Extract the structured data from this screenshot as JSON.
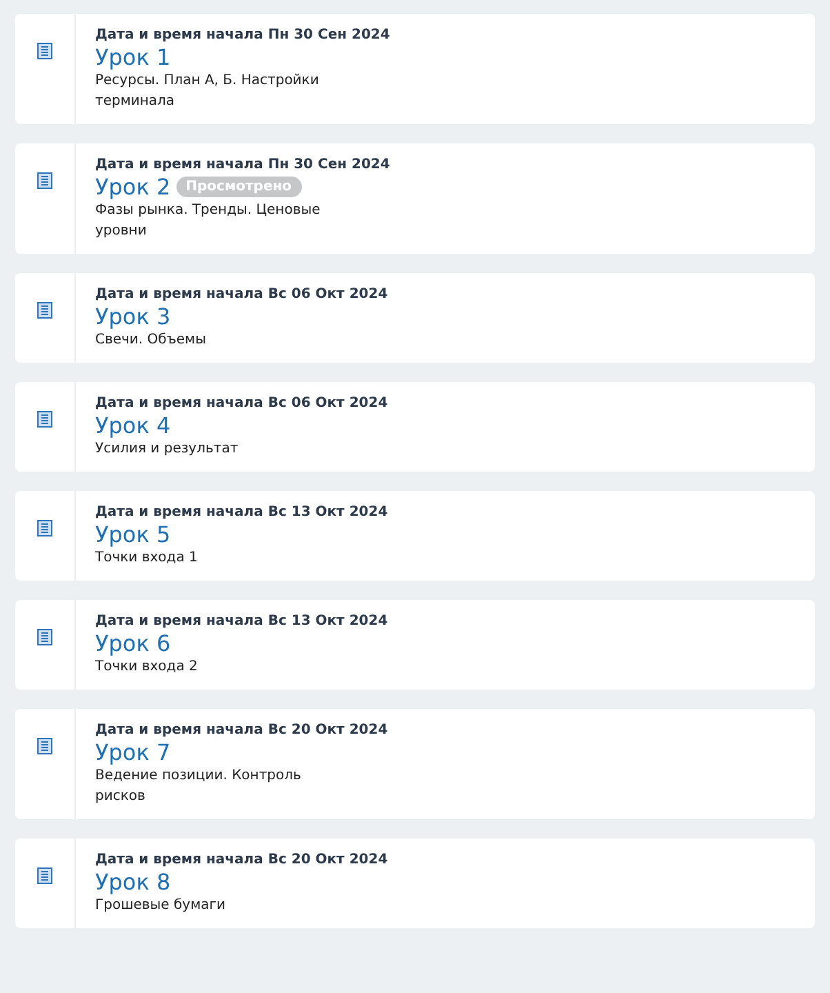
{
  "lessons": [
    {
      "date": "Дата и время начала Пн 30 Сен 2024",
      "title": "Урок 1",
      "viewed": false,
      "description": "Ресурсы. План А, Б. Настройки терминала"
    },
    {
      "date": "Дата и время начала Пн 30 Сен 2024",
      "title": "Урок 2",
      "viewed": true,
      "badge": "Просмотрено",
      "description": "Фазы рынка. Тренды. Ценовые уровни"
    },
    {
      "date": "Дата и время начала Вс 06 Окт 2024",
      "title": "Урок 3",
      "viewed": false,
      "description": "Свечи. Объемы"
    },
    {
      "date": "Дата и время начала Вс 06 Окт 2024",
      "title": "Урок 4",
      "viewed": false,
      "description": "Усилия и результат"
    },
    {
      "date": "Дата и время начала Вс 13 Окт 2024",
      "title": "Урок 5",
      "viewed": false,
      "description": "Точки входа 1"
    },
    {
      "date": "Дата и время начала Вс 13 Окт 2024",
      "title": "Урок 6",
      "viewed": false,
      "description": "Точки входа 2"
    },
    {
      "date": "Дата и время начала Вс 20 Окт 2024",
      "title": "Урок 7",
      "viewed": false,
      "description": "Ведение позиции. Контроль рисков"
    },
    {
      "date": "Дата и время начала Вс 20 Окт 2024",
      "title": "Урок 8",
      "viewed": false,
      "description": "Грошевые бумаги"
    }
  ]
}
